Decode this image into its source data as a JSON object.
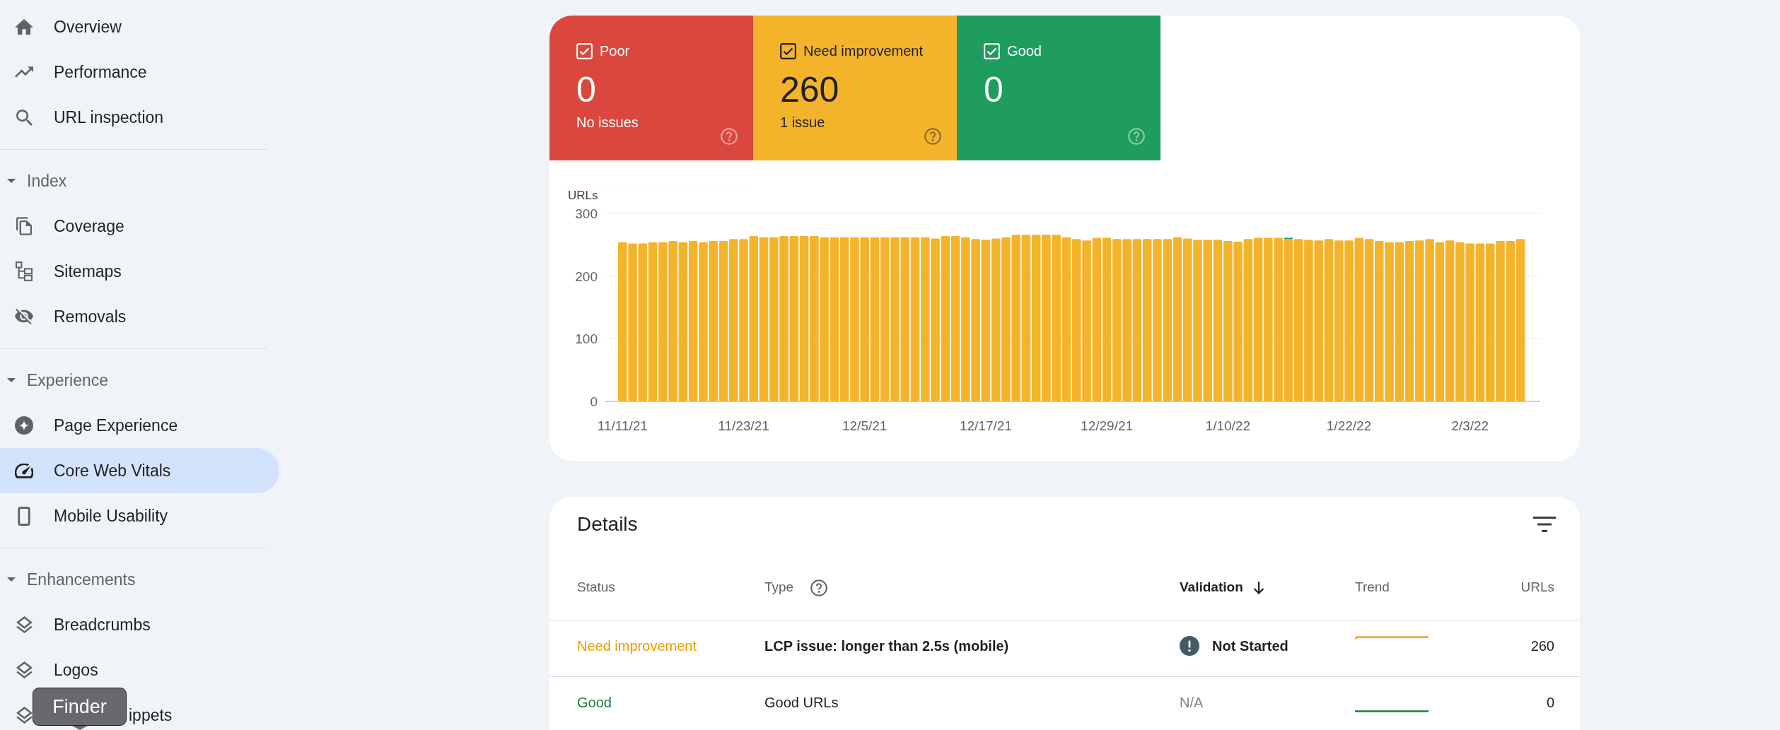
{
  "sidebar": {
    "groups": [
      {
        "items": [
          {
            "label": "Overview",
            "selected": false,
            "covered": false
          },
          {
            "label": "Performance",
            "selected": false,
            "covered": false
          },
          {
            "label": "URL inspection",
            "selected": false,
            "covered": false
          }
        ]
      },
      {
        "title": "Index",
        "expanded": true,
        "items": [
          {
            "label": "Coverage",
            "selected": false,
            "covered": false
          },
          {
            "label": "Sitemaps",
            "selected": false,
            "covered": false
          },
          {
            "label": "Removals",
            "selected": false,
            "covered": false
          }
        ]
      },
      {
        "title": "Experience",
        "expanded": true,
        "items": [
          {
            "label": "Page Experience",
            "selected": false,
            "covered": false
          },
          {
            "label": "Core Web Vitals",
            "selected": true,
            "covered": false
          },
          {
            "label": "Mobile Usability",
            "selected": false,
            "covered": false
          }
        ]
      },
      {
        "title": "Enhancements",
        "expanded": true,
        "items": [
          {
            "label": "Breadcrumbs",
            "selected": false,
            "covered": false
          },
          {
            "label": "Logos",
            "selected": false,
            "covered": false
          },
          {
            "label": "ippets",
            "selected": false,
            "covered": true
          }
        ]
      }
    ]
  },
  "summary": {
    "tiles": [
      {
        "label": "Poor",
        "checked": true,
        "count": "0",
        "note": "No issues",
        "color": "#d9473e"
      },
      {
        "label": "Need improvement",
        "checked": true,
        "count": "260",
        "note": "1 issue",
        "color": "#f3b42c"
      },
      {
        "label": "Good",
        "checked": true,
        "count": "0",
        "color": "#1e9d5e"
      }
    ],
    "chart_data": {
      "type": "bar",
      "ylabel": "URLs",
      "stacked": true,
      "ylim": [
        0,
        300
      ],
      "yticks": [
        0,
        100,
        200,
        300
      ],
      "categories": [
        "11/11/21",
        null,
        null,
        null,
        null,
        null,
        null,
        null,
        null,
        null,
        null,
        null,
        "11/23/21",
        null,
        null,
        null,
        null,
        null,
        null,
        null,
        null,
        null,
        null,
        null,
        "12/5/21",
        null,
        null,
        null,
        null,
        null,
        null,
        null,
        null,
        null,
        null,
        null,
        "12/17/21",
        null,
        null,
        null,
        null,
        null,
        null,
        null,
        null,
        null,
        null,
        null,
        "12/29/21",
        null,
        null,
        null,
        null,
        null,
        null,
        null,
        null,
        null,
        null,
        null,
        "1/10/22",
        null,
        null,
        null,
        null,
        null,
        null,
        null,
        null,
        null,
        null,
        null,
        "1/22/22",
        null,
        null,
        null,
        null,
        null,
        null,
        null,
        null,
        null,
        null,
        null,
        "2/3/22",
        null,
        null,
        null,
        null,
        null
      ],
      "series": [
        {
          "color": "#f3b42c",
          "values": [
            254,
            252,
            252,
            254,
            254,
            256,
            254,
            256,
            254,
            256,
            256,
            259,
            259,
            264,
            262,
            262,
            264,
            264,
            264,
            264,
            262,
            262,
            262,
            262,
            262,
            262,
            262,
            262,
            262,
            262,
            262,
            260,
            264,
            264,
            262,
            259,
            258,
            260,
            262,
            266,
            266,
            266,
            266,
            266,
            262,
            259,
            257,
            261,
            261,
            259,
            259,
            259,
            259,
            259,
            259,
            262,
            260,
            258,
            258,
            258,
            256,
            255,
            259,
            261,
            261,
            261,
            259,
            259,
            258,
            257,
            259,
            257,
            257,
            261,
            259,
            256,
            254,
            254,
            256,
            257,
            259,
            254,
            257,
            254,
            252,
            252,
            252,
            256,
            256,
            259
          ]
        },
        {
          "color": "#1e9d5e",
          "values": [
            0,
            0,
            0,
            0,
            0,
            0,
            0,
            0,
            0,
            0,
            0,
            0,
            0,
            0,
            0,
            0,
            0,
            0,
            0,
            0,
            0,
            0,
            0,
            0,
            0,
            0,
            0,
            0,
            0,
            0,
            0,
            0,
            0,
            0,
            0,
            0,
            0,
            0,
            0,
            0,
            0,
            0,
            0,
            0,
            0,
            0,
            0,
            0,
            0,
            0,
            0,
            0,
            0,
            0,
            0,
            0,
            0,
            0,
            0,
            0,
            0,
            0,
            0,
            0,
            0,
            0,
            2,
            0,
            0,
            0,
            0,
            0,
            0,
            0,
            0,
            0,
            0,
            0,
            0,
            0,
            0,
            0,
            0,
            0,
            0,
            0,
            0,
            0,
            0,
            0
          ]
        }
      ]
    }
  },
  "details": {
    "title": "Details",
    "columns": [
      {
        "label": "Status",
        "help": false,
        "sorted": false
      },
      {
        "label": "Type",
        "help": true,
        "sorted": false
      },
      {
        "label": "Validation",
        "help": false,
        "sorted": true
      },
      {
        "label": "Trend",
        "help": false,
        "sorted": false
      },
      {
        "label": "URLs",
        "help": false,
        "sorted": false
      }
    ],
    "rows": [
      {
        "kind": "issue",
        "status": "Need improvement",
        "color": "#f29900",
        "type": "LCP issue: longer than 2.5s (mobile)",
        "validation": {
          "kind": "not_started",
          "text": "Not Started"
        },
        "urls": "260"
      },
      {
        "kind": "good",
        "status": "Good",
        "color": "#188038",
        "type": "Good URLs",
        "validation": {
          "kind": "none",
          "text": "N/A"
        },
        "urls": "0"
      }
    ]
  },
  "tooltip": {
    "text": "Finder"
  }
}
